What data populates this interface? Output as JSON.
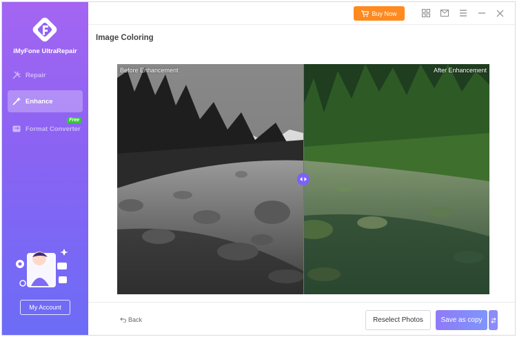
{
  "app": {
    "name": "iMyFone UltraRepair"
  },
  "sidebar": {
    "items": [
      {
        "label": "Repair",
        "icon": "repair-tools-icon",
        "active": false
      },
      {
        "label": "Enhance",
        "icon": "magic-wand-icon",
        "active": true
      },
      {
        "label": "Format Converter",
        "icon": "format-converter-icon",
        "active": false,
        "badge": "Free"
      }
    ],
    "account_label": "My Account"
  },
  "topbar": {
    "buy_label": "Buy Now",
    "icons": [
      "grid-icon",
      "mail-icon",
      "menu-icon",
      "minimize-icon",
      "close-icon"
    ],
    "accent": "#ff8a1f"
  },
  "main": {
    "title": "Image Coloring",
    "before_label": "Before Enhancement",
    "after_label": "After Enhancement",
    "split_position": 0.5
  },
  "bottombar": {
    "back_label": "Back",
    "reselect_label": "Reselect Photos",
    "save_label": "Save as copy"
  },
  "colors": {
    "sidebar_top": "#a465f2",
    "sidebar_bottom": "#6c6cf6",
    "divider": "#6f5cf6"
  }
}
